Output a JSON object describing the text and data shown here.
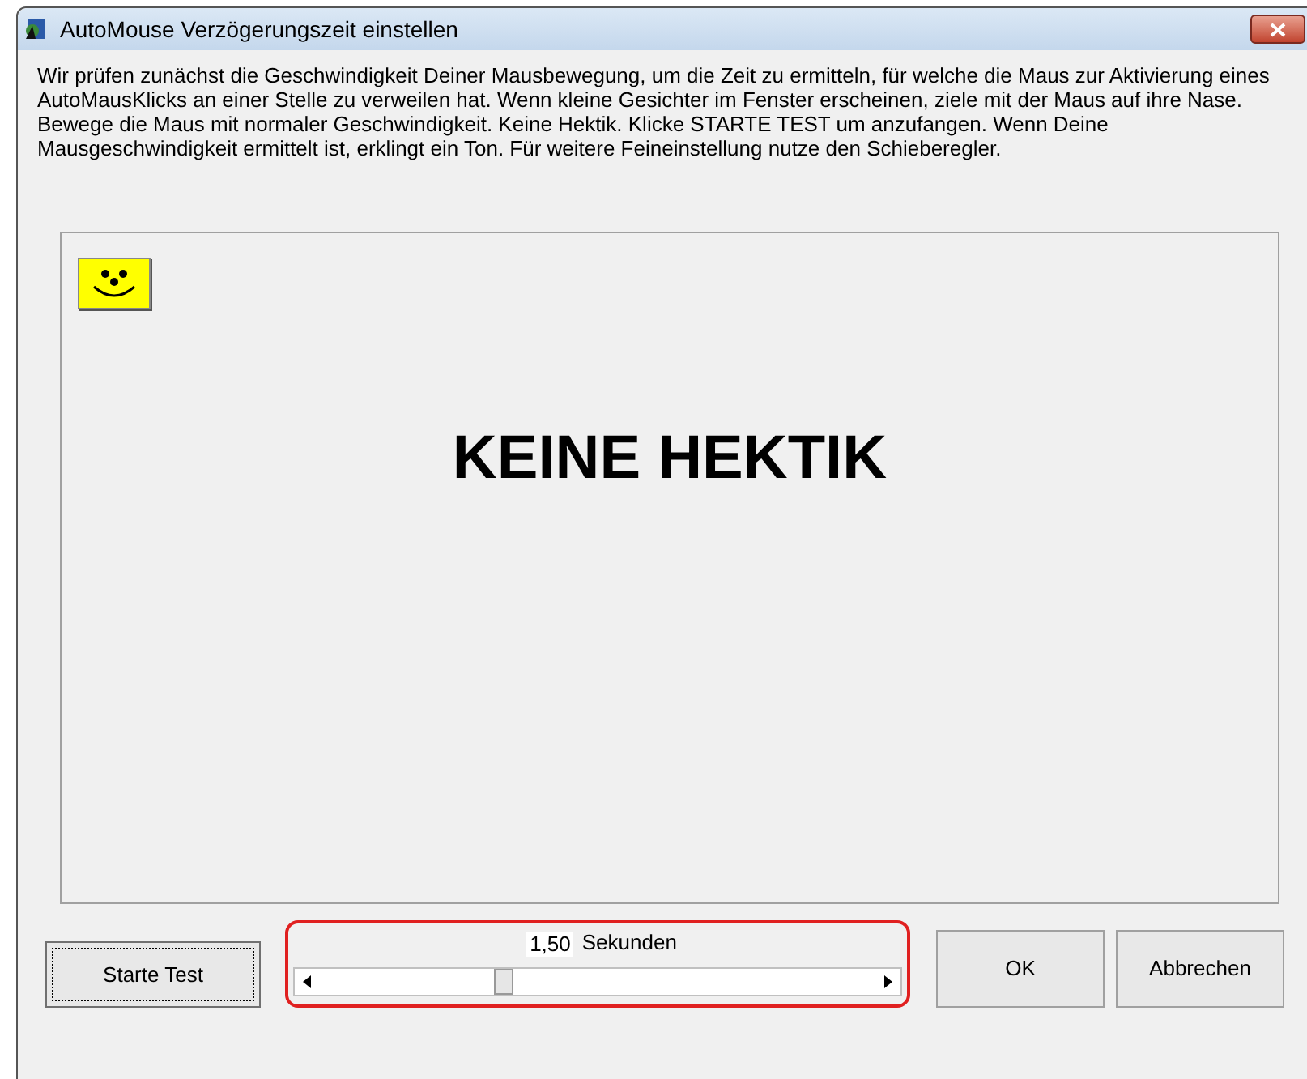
{
  "window": {
    "title": "AutoMouse Verzögerungszeit einstellen"
  },
  "instructions": "Wir prüfen zunächst die Geschwindigkeit Deiner Mausbewegung, um die Zeit zu ermitteln, für welche die Maus zur Aktivierung eines AutoMausKlicks an einer Stelle zu verweilen hat.  Wenn kleine Gesichter im Fenster erscheinen, ziele mit der Maus auf ihre Nase.  Bewege die Maus mit normaler Geschwindigkeit.  Keine Hektik.  Klicke STARTE TEST um anzufangen.  Wenn Deine Mausgeschwindigkeit ermittelt ist, erklingt ein Ton.  Für weitere Feineinstellung nutze den Schieberegler.",
  "test_area": {
    "message": "KEINE HEKTIK"
  },
  "start_button": "Starte Test",
  "delay": {
    "value": "1,50",
    "unit": "Sekunden",
    "level": 0.33
  },
  "buttons": [
    "OK",
    "Abbrechen"
  ]
}
